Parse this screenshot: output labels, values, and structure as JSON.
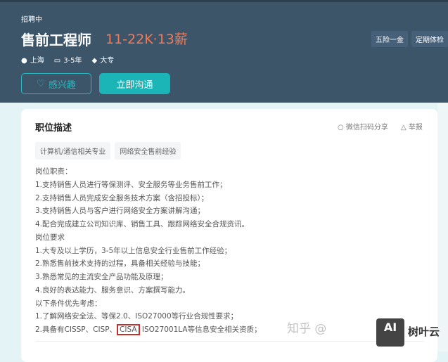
{
  "header": {
    "status": "招聘中",
    "title": "售前工程师",
    "salary": "11-22K·13薪",
    "meta": {
      "location": "上海",
      "experience": "3-5年",
      "education": "大专"
    },
    "benefits": [
      "五险一金",
      "定期体检"
    ],
    "interest_label": "感兴趣",
    "chat_label": "立即沟通"
  },
  "card": {
    "title": "职位描述",
    "share": "微信扫码分享",
    "report": "举报",
    "tags": [
      "计算机/通信相关专业",
      "网络安全售前经验"
    ],
    "lines": [
      "岗位职责：",
      "1.支持销售人员进行等保测评、安全服务等业务售前工作；",
      "2.支持销售人员完成安全服务技术方案（含招投标）；",
      "3.支持销售人员与客户进行网络安全方案讲解沟通；",
      "4.配合完成建立公司知识库、销售工具、跟踪网络安全合规资讯。",
      "岗位要求",
      "1.大专及以上学历，3-5年以上信息安全行业售前工作经验；",
      "2.熟悉售前技术支持的过程，具备相关经验与技能；",
      "3.熟悉常见的主流安全产品功能及原理；",
      "4.良好的表达能力、服务意识、方案撰写能力。",
      "以下条件优先考虑：",
      "1.了解网络安全法、等保2.0、ISO27000等行业合规性要求；"
    ],
    "last_line": {
      "before": "2.具备有CISSP、CISP、",
      "highlight": "CISA",
      "after": " ISO27001LA等信息安全相关资质；"
    }
  },
  "watermark": {
    "text": "知乎 @",
    "logo": "AI",
    "brand": "树叶云"
  }
}
